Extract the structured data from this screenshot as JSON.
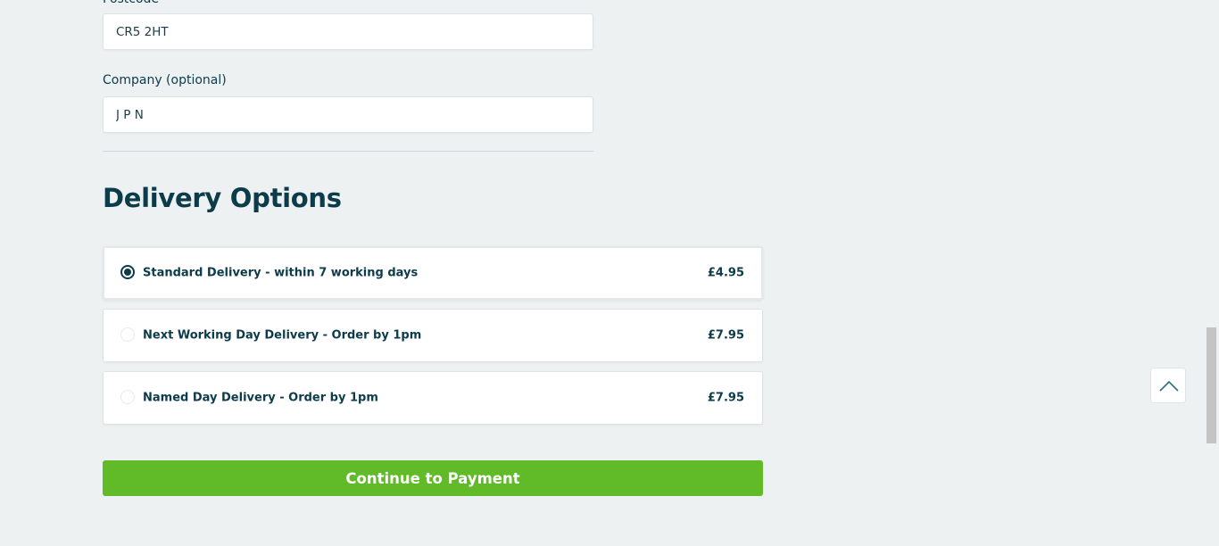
{
  "address_form": {
    "postcode": {
      "label": "Postcode",
      "value": "CR5 2HT"
    },
    "company": {
      "label": "Company (optional)",
      "value": "J P N"
    }
  },
  "delivery": {
    "title": "Delivery Options",
    "options": [
      {
        "label": "Standard Delivery - within 7 working days",
        "price": "£4.95",
        "selected": true
      },
      {
        "label": "Next Working Day Delivery - Order by 1pm",
        "price": "£7.95",
        "selected": false
      },
      {
        "label": "Named Day Delivery - Order by 1pm",
        "price": "£7.95",
        "selected": false
      }
    ]
  },
  "actions": {
    "continue_label": "Continue to Payment"
  },
  "back_to_top_icon": "chevron-up-icon",
  "colors": {
    "accent": "#61ba27",
    "text": "#0c3b4a",
    "background": "#edf1f1"
  }
}
